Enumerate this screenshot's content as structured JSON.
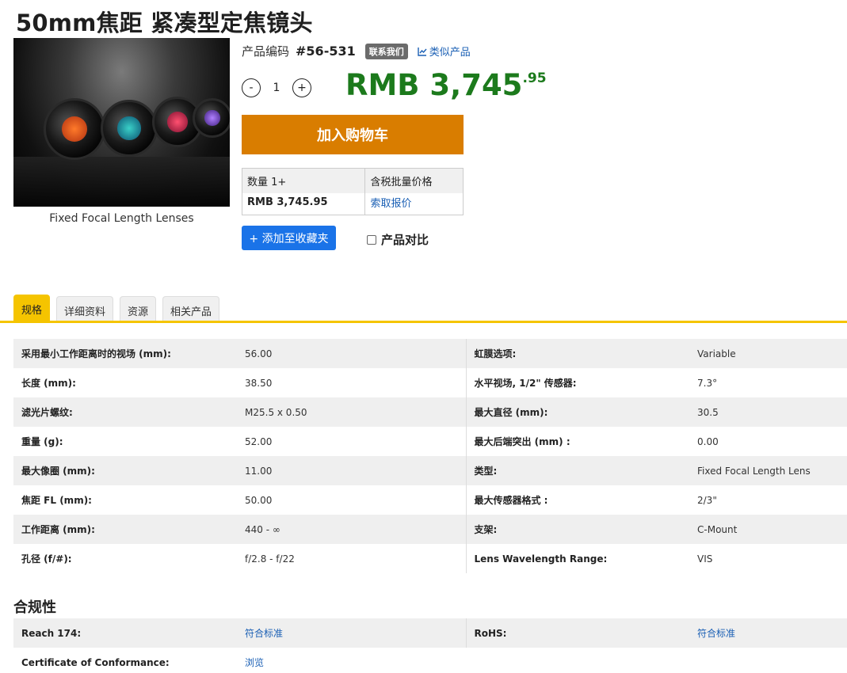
{
  "title": "50mm焦距 紧凑型定焦镜头",
  "image_caption": "Fixed Focal Length Lenses",
  "sku": {
    "label": "产品编码",
    "value": "#56-531",
    "contact": "联系我们",
    "similar": "类似产品"
  },
  "quantity": {
    "value": "1",
    "minus": "-",
    "plus": "+"
  },
  "price": {
    "main": "RMB 3,745",
    "cents": ".95",
    "color": "#1c7a1c"
  },
  "cart_button": "加入购物车",
  "price_table": {
    "qty_header": "数量 1+",
    "price_header": "含税批量价格",
    "price": "RMB 3,745.95",
    "quote_link": "索取报价"
  },
  "favorite_button": "+ 添加至收藏夹",
  "compare_label": "产品对比",
  "tabs": [
    "规格",
    "详细资料",
    "资源",
    "相关产品"
  ],
  "specs": [
    {
      "k1": "采用最小工作距离时的视场 (mm):",
      "v1": "56.00",
      "k2": "虹膜选项:",
      "v2": "Variable"
    },
    {
      "k1": "长度 (mm):",
      "v1": "38.50",
      "k2": "水平视场, 1/2\" 传感器:",
      "v2": "7.3°"
    },
    {
      "k1": "滤光片螺纹:",
      "v1": "M25.5 x 0.50",
      "k2": "最大直径 (mm):",
      "v2": "30.5"
    },
    {
      "k1": "重量 (g):",
      "v1": "52.00",
      "k2": "最大后端突出 (mm) :",
      "v2": "0.00"
    },
    {
      "k1": "最大像圈 (mm):",
      "v1": "11.00",
      "k2": "类型:",
      "v2": "Fixed Focal Length Lens"
    },
    {
      "k1": "焦距 FL (mm):",
      "v1": "50.00",
      "k2": "最大传感器格式 :",
      "v2": "2/3\""
    },
    {
      "k1": "工作距离 (mm):",
      "v1": "440 - ∞",
      "k2": "支架:",
      "v2": "C-Mount"
    },
    {
      "k1": "孔径 (f/#):",
      "v1": "f/2.8 - f/22",
      "k2": "Lens Wavelength Range:",
      "v2": "VIS"
    }
  ],
  "compliance_title": "合规性",
  "compliance": [
    {
      "k1": "Reach 174:",
      "v1": "符合标准",
      "k2": "RoHS:",
      "v2": "符合标准"
    },
    {
      "k1": "Certificate of Conformance:",
      "v1": "浏览",
      "k2": "",
      "v2": ""
    }
  ],
  "colors": {
    "accent_orange": "#d97d00",
    "tab_yellow": "#f5c400",
    "link_blue": "#1a5fb4",
    "fav_blue": "#1a73e8"
  }
}
